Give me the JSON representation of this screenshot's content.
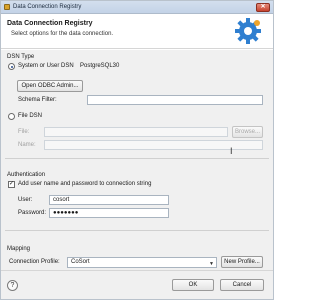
{
  "window": {
    "title": "Data Connection Registry",
    "close_icon": "close-icon"
  },
  "header": {
    "title": "Data Connection Registry",
    "subtitle": "Select options for the data connection.",
    "icon": "gear-icon"
  },
  "dsn_type": {
    "section_label": "DSN Type",
    "system_user_dsn_label": "System or User DSN",
    "system_user_dsn_value": "PostgreSQL30",
    "open_odbc_admin_label": "Open ODBC Admin...",
    "schema_filter_label": "Schema Filter:",
    "schema_filter_value": "",
    "file_dsn_label": "File DSN",
    "file_label": "File:",
    "file_value": "",
    "browse_label": "Browse...",
    "name_label": "Name:",
    "name_value": ""
  },
  "authentication": {
    "section_label": "Authentication",
    "add_credentials_label": "Add user name and password to connection string",
    "add_credentials_checked": "✓",
    "user_label": "User:",
    "user_value": "cosort",
    "password_label": "Password:",
    "password_value": "●●●●●●●"
  },
  "mapping": {
    "section_label": "Mapping",
    "connection_profile_label": "Connection Profile:",
    "connection_profile_value": "CoSort",
    "new_profile_label": "New Profile..."
  },
  "footer": {
    "help_icon_glyph": "?",
    "ok_label": "OK",
    "cancel_label": "Cancel"
  }
}
